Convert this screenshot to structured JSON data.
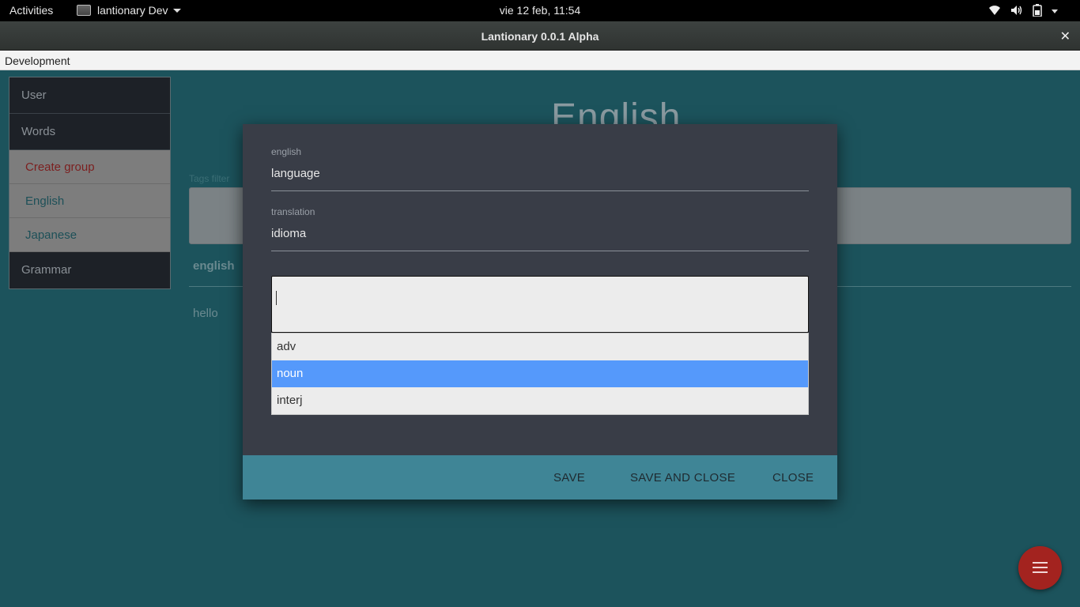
{
  "topbar": {
    "activities": "Activities",
    "app_name": "lantionary Dev",
    "clock": "vie 12 feb, 11:54",
    "icons": [
      "wifi-icon",
      "volume-icon",
      "battery-icon",
      "system-menu-caret-icon"
    ]
  },
  "window": {
    "title": "Lantionary 0.0.1 Alpha",
    "close_glyph": "✕"
  },
  "menubar": {
    "items": [
      "Development"
    ]
  },
  "sidebar": {
    "items": [
      {
        "label": "User"
      },
      {
        "label": "Words"
      },
      {
        "label": "Create group",
        "color": "#7c1f1f"
      },
      {
        "label": "English",
        "color": "#1d5058"
      },
      {
        "label": "Japanese",
        "color": "#1d5058"
      },
      {
        "label": "Grammar"
      }
    ]
  },
  "page": {
    "title": "English",
    "tags_filter_label": "Tags filter",
    "column_header": "english",
    "rows": [
      "hello"
    ]
  },
  "dialog": {
    "english_label": "english",
    "english_value": "language",
    "translation_label": "translation",
    "translation_value": "idioma",
    "tag_input_value": "",
    "options": [
      {
        "label": "adv",
        "selected": false
      },
      {
        "label": "noun",
        "selected": true
      },
      {
        "label": "interj",
        "selected": false
      }
    ],
    "buttons": {
      "save": "SAVE",
      "save_and_close": "SAVE AND CLOSE",
      "close": "CLOSE"
    }
  },
  "fab": {
    "icon": "menu-icon",
    "color": "#a3231f"
  },
  "colors": {
    "accent_selection": "#5599fb",
    "dialog_footer": "#3f8596",
    "content_background": "#1c535c"
  }
}
